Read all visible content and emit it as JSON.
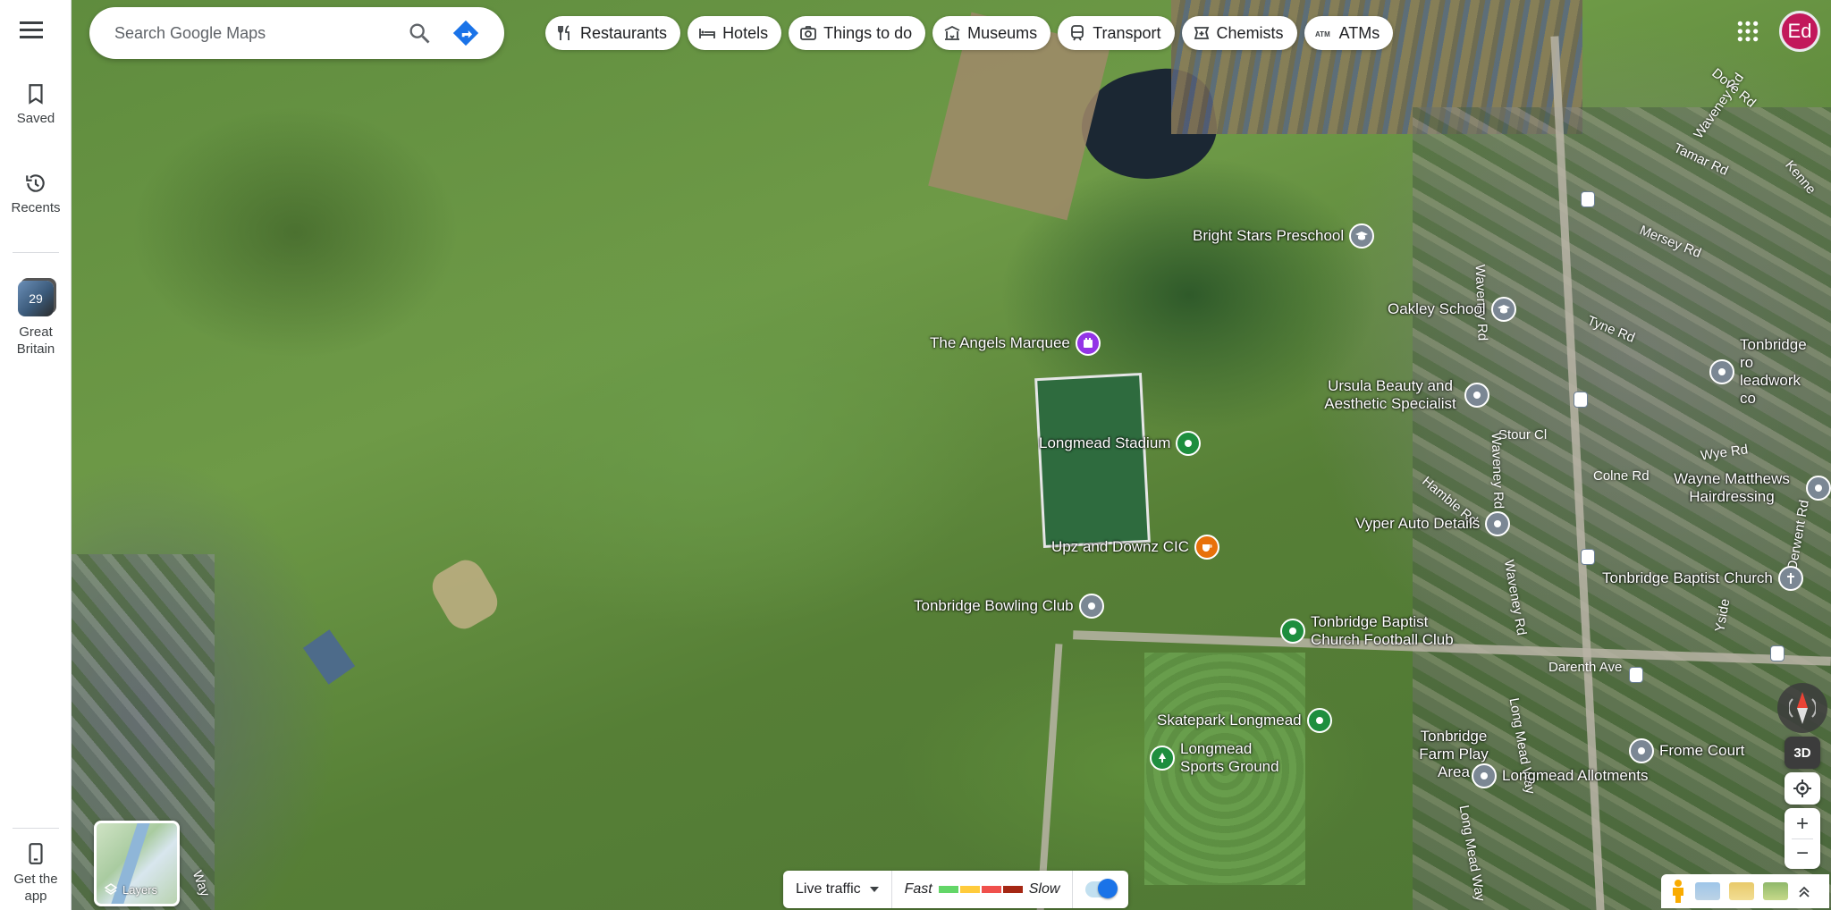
{
  "rail": {
    "saved": "Saved",
    "recents": "Recents",
    "list_count": "29",
    "list_name": "Great Britain",
    "get_app": "Get the app"
  },
  "search": {
    "placeholder": "Search Google Maps"
  },
  "chips": [
    {
      "label": "Restaurants",
      "icon": "restaurant-icon"
    },
    {
      "label": "Hotels",
      "icon": "hotel-icon"
    },
    {
      "label": "Things to do",
      "icon": "camera-icon"
    },
    {
      "label": "Museums",
      "icon": "museum-icon"
    },
    {
      "label": "Transport",
      "icon": "train-icon"
    },
    {
      "label": "Chemists",
      "icon": "pharmacy-icon"
    },
    {
      "label": "ATMs",
      "icon": "atm-icon"
    }
  ],
  "account": {
    "initials": "Ed",
    "color": "#c2185b"
  },
  "places": {
    "bright_stars": "Bright Stars Preschool",
    "oakley": "Oakley School",
    "angels": "The Angels Marquee",
    "ursula": "Ursula Beauty and Aesthetic Specialist",
    "longmead_stadium": "Longmead Stadium",
    "upz": "Upz and Downz CIC",
    "bowling": "Tonbridge Bowling Club",
    "baptist_fc": "Tonbridge Baptist Church Football Club",
    "skatepark": "Skatepark Longmead",
    "sports_ground": "Longmead Sports Ground",
    "farm": "Tonbridge Farm Play Area",
    "vyper": "Vyper Auto Details",
    "wayne": "Wayne Matthews Hairdressing",
    "baptist_church": "Tonbridge Baptist Church",
    "tonbridge_road": "Tonbridge ro leadwork co",
    "frome": "Frome Court",
    "allotments": "Longmead Allotments"
  },
  "streets": {
    "waveney_top": "Waveney Rd",
    "dove": "Dove Rd",
    "tamar": "Tamar Rd",
    "mersey": "Mersey Rd",
    "tyne": "Tyne Rd",
    "stour": "Stour Cl",
    "colne": "Colne Rd",
    "wye": "Wye Rd",
    "hamble": "Hamble Rd",
    "darenth": "Darenth Ave",
    "long_mead": "Long Mead Way",
    "waveney_mid": "Waveney Rd",
    "waveney_low": "Waveney Rd",
    "kenne": "Kenne",
    "yside": "Yside",
    "derwent": "Derwent Rd",
    "waveney_side": "Waveney Rd",
    "long_mead_btm": "Long Mead Way",
    "lw_corner": "Way"
  },
  "layers": {
    "label": "Layers"
  },
  "traffic": {
    "mode": "Live traffic",
    "fast": "Fast",
    "slow": "Slow",
    "colors": [
      "#63d668",
      "#ffcb3c",
      "#f0504c",
      "#a52714"
    ]
  },
  "controls": {
    "three_d": "3D"
  },
  "pin_colors": {
    "green": "#1e8e3e",
    "grey": "#7b8794",
    "purple": "#9334e6",
    "orange": "#e8710a",
    "teal": "#129eaf"
  }
}
